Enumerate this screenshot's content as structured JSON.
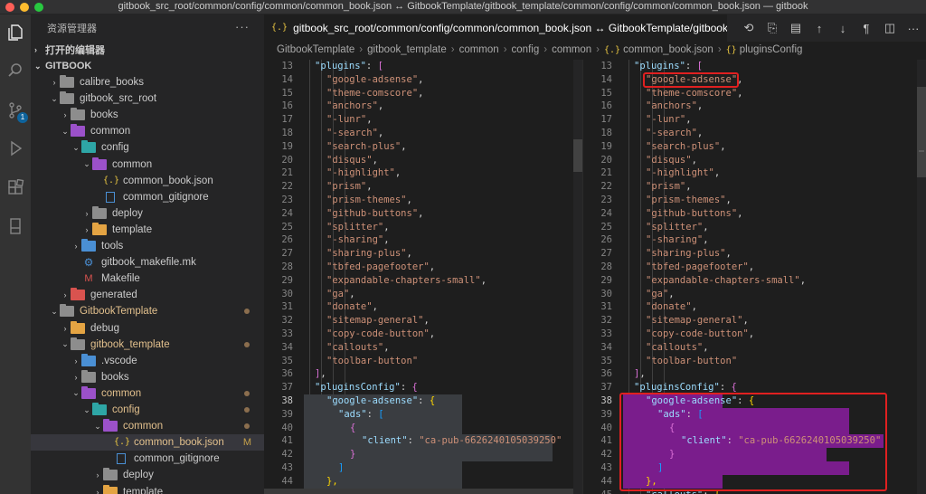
{
  "window": {
    "title": "gitbook_src_root/common/config/common/common_book.json ↔ GitbookTemplate/gitbook_template/common/config/common/common_book.json — gitbook"
  },
  "activity": {
    "scm_badge": "1"
  },
  "sidebar": {
    "header": "资源管理器",
    "more": "···",
    "open_editors": "打开的编辑器",
    "root": "GITBOOK",
    "items": [
      {
        "label": "calibre_books",
        "depth": 1,
        "kind": "folder",
        "chev": "›"
      },
      {
        "label": "gitbook_src_root",
        "depth": 1,
        "kind": "folder",
        "chev": "⌄"
      },
      {
        "label": "books",
        "depth": 2,
        "kind": "folder",
        "chev": "›"
      },
      {
        "label": "common",
        "depth": 2,
        "kind": "folder-purple",
        "chev": "⌄"
      },
      {
        "label": "config",
        "depth": 3,
        "kind": "folder-teal",
        "chev": "⌄"
      },
      {
        "label": "common",
        "depth": 4,
        "kind": "folder-purple",
        "chev": "⌄"
      },
      {
        "label": "common_book.json",
        "depth": 5,
        "kind": "json",
        "chev": ""
      },
      {
        "label": "common_gitignore",
        "depth": 5,
        "kind": "file",
        "chev": ""
      },
      {
        "label": "deploy",
        "depth": 4,
        "kind": "folder",
        "chev": "›"
      },
      {
        "label": "template",
        "depth": 4,
        "kind": "folder-orange",
        "chev": "›"
      },
      {
        "label": "tools",
        "depth": 3,
        "kind": "folder-blue",
        "chev": "›"
      },
      {
        "label": "gitbook_makefile.mk",
        "depth": 3,
        "kind": "gear",
        "chev": ""
      },
      {
        "label": "Makefile",
        "depth": 3,
        "kind": "make",
        "chev": ""
      },
      {
        "label": "generated",
        "depth": 2,
        "kind": "folder-red",
        "chev": "›"
      },
      {
        "label": "GitbookTemplate",
        "depth": 1,
        "kind": "folder",
        "chev": "⌄",
        "mod": true,
        "dot": true
      },
      {
        "label": "debug",
        "depth": 2,
        "kind": "folder-orange",
        "chev": "›"
      },
      {
        "label": "gitbook_template",
        "depth": 2,
        "kind": "folder",
        "chev": "⌄",
        "mod": true,
        "dot": true
      },
      {
        "label": ".vscode",
        "depth": 3,
        "kind": "folder-blue",
        "chev": "›"
      },
      {
        "label": "books",
        "depth": 3,
        "kind": "folder",
        "chev": "›"
      },
      {
        "label": "common",
        "depth": 3,
        "kind": "folder-purple",
        "chev": "⌄",
        "mod": true,
        "dot": true
      },
      {
        "label": "config",
        "depth": 4,
        "kind": "folder-teal",
        "chev": "⌄",
        "mod": true,
        "dot": true
      },
      {
        "label": "common",
        "depth": 5,
        "kind": "folder-purple",
        "chev": "⌄",
        "mod": true,
        "dot": true
      },
      {
        "label": "common_book.json",
        "depth": 6,
        "kind": "json",
        "chev": "",
        "mod": true,
        "status": "M",
        "selected": true
      },
      {
        "label": "common_gitignore",
        "depth": 6,
        "kind": "file",
        "chev": ""
      },
      {
        "label": "deploy",
        "depth": 5,
        "kind": "folder",
        "chev": "›"
      },
      {
        "label": "template",
        "depth": 5,
        "kind": "folder-orange",
        "chev": "›"
      }
    ]
  },
  "tab": {
    "icon": "{.}",
    "label": "gitbook_src_root/common/config/common/common_book.json ↔ GitbookTemplate/gitbook_templ"
  },
  "toolbar": {
    "icons": [
      "history-icon",
      "open-file-icon",
      "book-icon",
      "arrow-up-icon",
      "arrow-down-icon",
      "pilcrow-icon",
      "split-editor-icon",
      "more-icon"
    ],
    "glyphs": [
      "⟲",
      "⎘",
      "▤",
      "↑",
      "↓",
      "¶",
      "◫",
      "···"
    ]
  },
  "breadcrumb": {
    "items": [
      "GitbookTemplate",
      "gitbook_template",
      "common",
      "config",
      "common"
    ],
    "file_icon": "{.}",
    "file": "common_book.json",
    "symbol_icon": "{}",
    "symbol": "pluginsConfig"
  },
  "editor": {
    "line_numbers": [
      "13",
      "14",
      "15",
      "16",
      "17",
      "18",
      "19",
      "20",
      "21",
      "22",
      "23",
      "24",
      "25",
      "26",
      "27",
      "28",
      "29",
      "30",
      "31",
      "32",
      "33",
      "34",
      "35",
      "36",
      "37",
      "38",
      "39",
      "40",
      "41",
      "42",
      "43",
      "44",
      "45"
    ],
    "current_line": "38",
    "plugins_key": "\"plugins\"",
    "plugins": [
      "\"google-adsense\"",
      "\"theme-comscore\"",
      "\"anchors\"",
      "\"-lunr\"",
      "\"-search\"",
      "\"search-plus\"",
      "\"disqus\"",
      "\"-highlight\"",
      "\"prism\"",
      "\"prism-themes\"",
      "\"github-buttons\"",
      "\"splitter\"",
      "\"-sharing\"",
      "\"sharing-plus\"",
      "\"tbfed-pagefooter\"",
      "\"expandable-chapters-small\"",
      "\"ga\"",
      "\"donate\"",
      "\"sitemap-general\"",
      "\"copy-code-button\"",
      "\"callouts\"",
      "\"toolbar-button\""
    ],
    "plugins_config_key": "\"pluginsConfig\"",
    "adsense_key": "\"google-adsense\"",
    "ads_key": "\"ads\"",
    "client_key": "\"client\"",
    "client_value": "\"ca-pub-6626240105039250\"",
    "callouts_key": "\"callouts\"",
    "colon": ": ",
    "comma": ",",
    "open_bracket": "[",
    "close_bracket": "]",
    "close_bracket_comma": "],",
    "open_brace": "{",
    "close_brace": "}",
    "close_brace_comma": "},"
  },
  "colors": {
    "highlight_purple": "#7a1d8c",
    "annotation_red": "#e02020",
    "string": "#ce9178",
    "key": "#9cdcfe"
  }
}
